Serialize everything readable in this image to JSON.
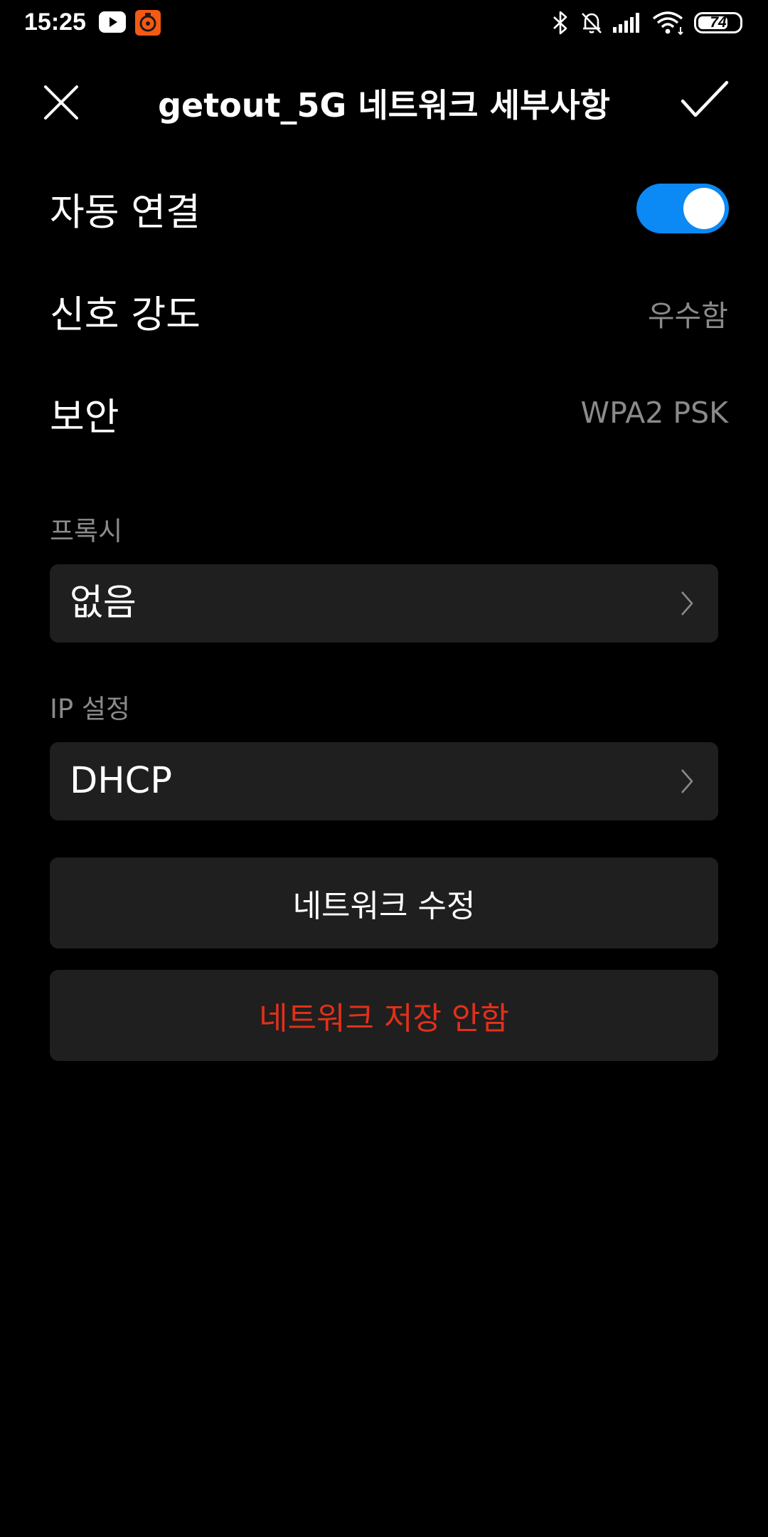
{
  "status_bar": {
    "time": "15:25",
    "battery_level": "74",
    "battery_fraction": 0.74,
    "icons": [
      "youtube-icon",
      "app-notification-icon",
      "bluetooth-icon",
      "bell-muted-icon",
      "signal-icon",
      "wifi-icon",
      "battery-icon"
    ]
  },
  "header": {
    "title": "getout_5G 네트워크 세부사항",
    "close_icon": "close-icon",
    "confirm_icon": "check-icon"
  },
  "rows": {
    "auto_connect": {
      "label": "자동 연결",
      "enabled": true
    },
    "signal_strength": {
      "label": "신호 강도",
      "value": "우수함"
    },
    "security": {
      "label": "보안",
      "value": "WPA2 PSK"
    }
  },
  "proxy": {
    "section_label": "프록시",
    "value": "없음"
  },
  "ip_settings": {
    "section_label": "IP 설정",
    "value": "DHCP"
  },
  "actions": {
    "modify_label": "네트워크 수정",
    "forget_label": "네트워크 저장 안함"
  },
  "colors": {
    "background": "#000000",
    "card": "#1f1f1f",
    "accent": "#0b89f5",
    "danger": "#e2301a",
    "secondary_text": "#8a8a8a"
  }
}
